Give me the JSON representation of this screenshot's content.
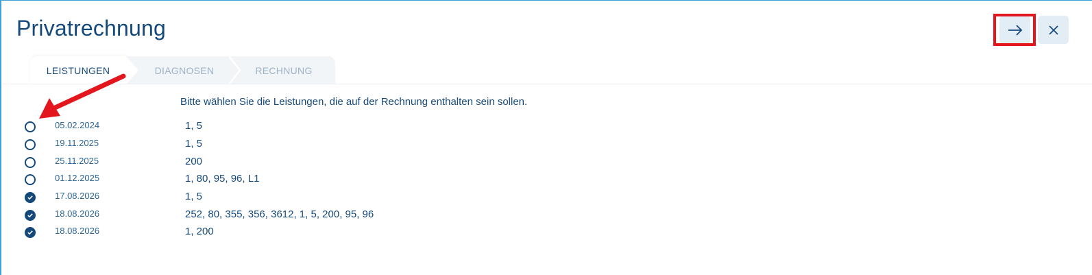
{
  "header": {
    "title": "Privatrechnung",
    "next_icon": "arrow-right-icon",
    "close_icon": "close-icon"
  },
  "tabs": [
    {
      "label": "LEISTUNGEN",
      "active": true
    },
    {
      "label": "DIAGNOSEN",
      "active": false
    },
    {
      "label": "RECHNUNG",
      "active": false
    }
  ],
  "instruction": "Bitte wählen Sie die Leistungen, die auf der Rechnung enthalten sein sollen.",
  "rows": [
    {
      "date": "05.02.2024",
      "codes": "1, 5",
      "selected": false
    },
    {
      "date": "19.11.2025",
      "codes": "1, 5",
      "selected": false
    },
    {
      "date": "25.11.2025",
      "codes": "200",
      "selected": false
    },
    {
      "date": "01.12.2025",
      "codes": "1, 80, 95, 96, L1",
      "selected": false
    },
    {
      "date": "17.08.2026",
      "codes": "1, 5",
      "selected": true
    },
    {
      "date": "18.08.2026",
      "codes": "252, 80, 355, 356, 3612, 1, 5, 200, 95, 96",
      "selected": true
    },
    {
      "date": "18.08.2026",
      "codes": "1, 200",
      "selected": true
    }
  ],
  "colors": {
    "primary": "#15497a",
    "inactive_tab": "#9db2c6",
    "annotation_red": "#e3161d",
    "button_bg": "#e3edf5"
  }
}
